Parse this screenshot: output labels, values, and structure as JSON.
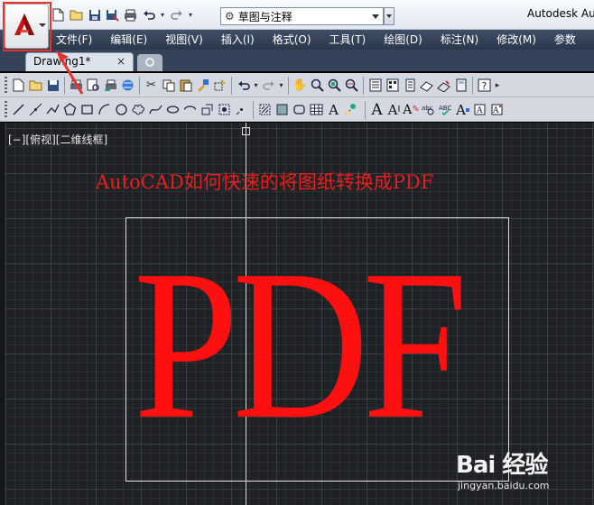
{
  "app": {
    "title": "Autodesk Aut",
    "workspace": "草图与注释",
    "accent": "#e8322c"
  },
  "menu": {
    "items": [
      {
        "label": "文件(F)"
      },
      {
        "label": "编辑(E)"
      },
      {
        "label": "视图(V)"
      },
      {
        "label": "插入(I)"
      },
      {
        "label": "格式(O)"
      },
      {
        "label": "工具(T)"
      },
      {
        "label": "绘图(D)"
      },
      {
        "label": "标注(N)"
      },
      {
        "label": "修改(M)"
      },
      {
        "label": "参数"
      }
    ]
  },
  "tabs": {
    "active": "Drawing1*",
    "close_glyph": "×"
  },
  "viewport": {
    "label": "[−][俯视][二维线框]",
    "title_text": "AutoCAD如何快速的将图纸转换成PDF",
    "big_text": "PDF"
  },
  "watermark": {
    "brand": "Bai 经验",
    "url": "jingyan.baidu.com"
  },
  "icons": {
    "app_menu": "autocad-logo-icon",
    "annotation": "red-arrow-icon"
  }
}
